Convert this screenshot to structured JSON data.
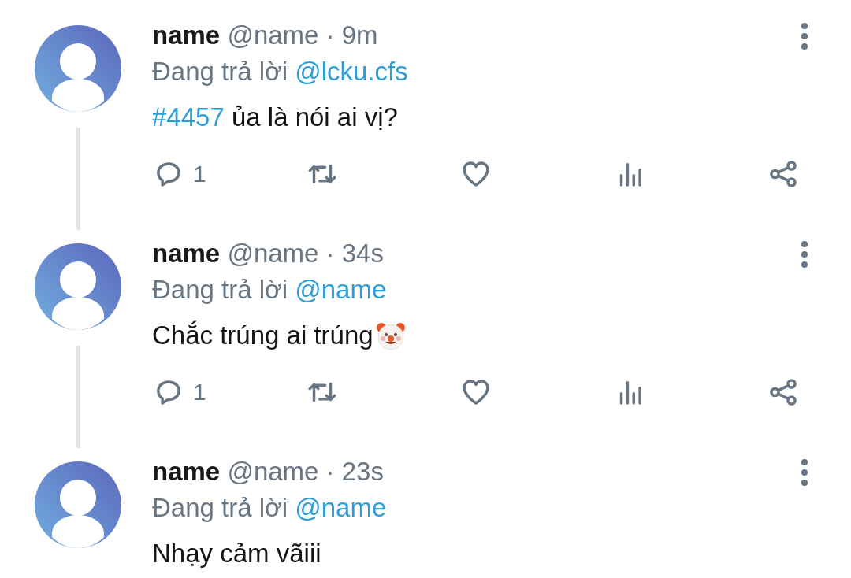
{
  "tweets": [
    {
      "name": "name",
      "handle": "@name",
      "time": "· 9m",
      "reply_label": "Đang trả lời",
      "reply_to": "@lcku.cfs",
      "connected": true,
      "body": [
        {
          "kind": "hashtag",
          "text": "#4457"
        },
        {
          "kind": "text",
          "text": " ủa là nói ai vị?"
        }
      ],
      "actions": [
        {
          "kind": "reply",
          "count": "1"
        },
        {
          "kind": "retweet"
        },
        {
          "kind": "like"
        },
        {
          "kind": "views"
        },
        {
          "kind": "share"
        }
      ]
    },
    {
      "name": "name",
      "handle": "@name",
      "time": "· 34s",
      "reply_label": "Đang trả lời",
      "reply_to": "@name",
      "connected": true,
      "body": [
        {
          "kind": "text",
          "text": "Chắc trúng ai trúng"
        },
        {
          "kind": "clown_emoji"
        }
      ],
      "actions": [
        {
          "kind": "reply",
          "count": "1"
        },
        {
          "kind": "retweet"
        },
        {
          "kind": "like"
        },
        {
          "kind": "views"
        },
        {
          "kind": "share"
        }
      ]
    },
    {
      "name": "name",
      "handle": "@name",
      "time": "· 23s",
      "reply_label": "Đang trả lời",
      "reply_to": "@name",
      "connected": false,
      "body": [
        {
          "kind": "text",
          "text": "Nhạy cảm vãiii"
        }
      ]
    }
  ]
}
